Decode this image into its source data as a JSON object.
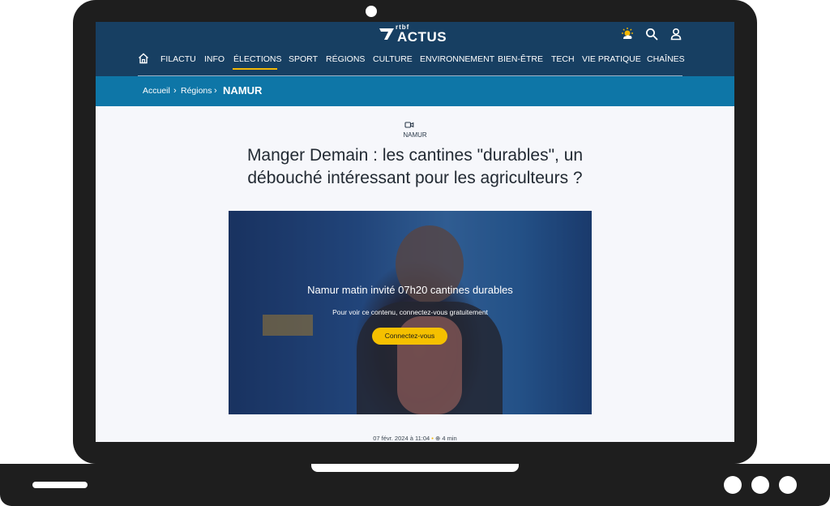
{
  "header": {
    "logo_small": "rtbf",
    "logo_main": "ACTUS",
    "icons": [
      "weather-icon",
      "search-icon",
      "user-icon"
    ]
  },
  "nav": {
    "items": [
      "FILACTU",
      "INFO",
      "ÉLECTIONS",
      "SPORT",
      "RÉGIONS",
      "CULTURE",
      "ENVIRONNEMENT",
      "BIEN-ÊTRE",
      "TECH",
      "VIE PRATIQUE",
      "CHAÎNES"
    ],
    "active": "ÉLECTIONS"
  },
  "breadcrumb": {
    "items": [
      "Accueil",
      "Régions"
    ],
    "current": "NAMUR"
  },
  "article": {
    "section": "NAMUR",
    "title": "Manger Demain : les cantines \"durables\", un débouché intéressant pour les agriculteurs ?",
    "video": {
      "title": "Namur matin invité 07h20 cantines durables",
      "subtitle": "Pour voir ce contenu, connectez-vous gratuitement",
      "button": "Connectez-vous"
    },
    "meta": {
      "date": "07 févr. 2024 à 11:04",
      "read_time": "4 min"
    }
  },
  "colors": {
    "topbar": "#173f62",
    "breadcrumb_bar": "#0e76a7",
    "accent": "#f2b705",
    "button": "#f5c000"
  }
}
